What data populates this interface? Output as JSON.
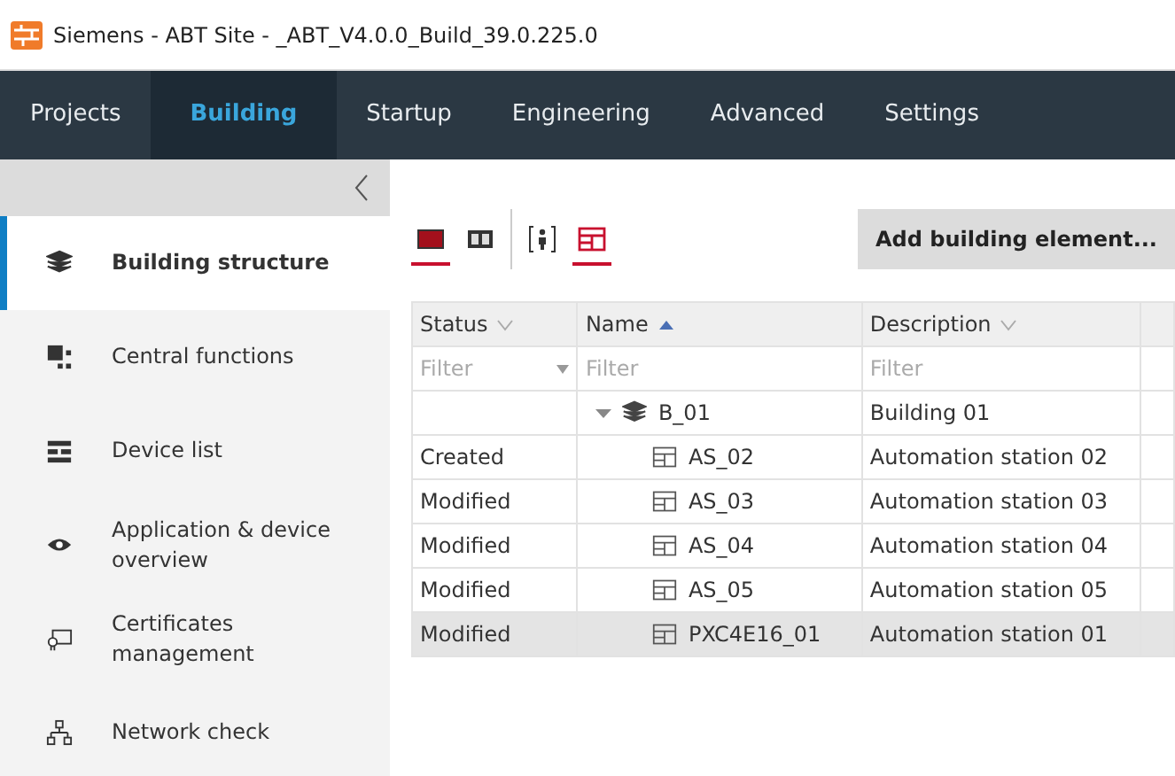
{
  "window": {
    "title": "Siemens - ABT Site - _ABT_V4.0.0_Build_39.0.225.0"
  },
  "menu_tabs": [
    {
      "label": "Projects",
      "selected": false
    },
    {
      "label": "Building",
      "selected": true
    },
    {
      "label": "Startup",
      "selected": false
    },
    {
      "label": "Engineering",
      "selected": false
    },
    {
      "label": "Advanced",
      "selected": false
    },
    {
      "label": "Settings",
      "selected": false
    }
  ],
  "sidebar": {
    "items": [
      {
        "label": "Building structure",
        "kind": "layers",
        "selected": true
      },
      {
        "label": "Central functions",
        "kind": "blocks",
        "selected": false
      },
      {
        "label": "Device list",
        "kind": "list",
        "selected": false
      },
      {
        "label": "Application & device overview",
        "kind": "eye",
        "selected": false
      },
      {
        "label": "Certificates management",
        "kind": "certificate",
        "selected": false
      },
      {
        "label": "Network check",
        "kind": "network",
        "selected": false
      }
    ]
  },
  "view_toggles": [
    {
      "kind": "full",
      "selected": true
    },
    {
      "kind": "split",
      "selected": false
    },
    {
      "kind": "person",
      "selected": false
    },
    {
      "kind": "station",
      "selected": true
    }
  ],
  "add_button": "Add building element...",
  "table": {
    "columns": [
      {
        "label": "Status",
        "sort_ascending": false,
        "filter_placeholder": "Filter",
        "filter_dropdown": true
      },
      {
        "label": "Name",
        "sort_ascending": true,
        "filter_placeholder": "Filter",
        "filter_dropdown": false
      },
      {
        "label": "Description",
        "sort_ascending": false,
        "filter_placeholder": "Filter",
        "filter_dropdown": false
      }
    ],
    "rows": [
      {
        "name": "B_01",
        "kind": "building",
        "description": "Building 01",
        "expanded": true,
        "selected": false,
        "children": [
          {
            "status": "Created",
            "name": "AS_02",
            "kind": "station",
            "description": "Automation station 02",
            "selected": false
          },
          {
            "status": "Modified",
            "name": "AS_03",
            "kind": "station",
            "description": "Automation station 03",
            "selected": false
          },
          {
            "status": "Modified",
            "name": "AS_04",
            "kind": "station",
            "description": "Automation station 04",
            "selected": false
          },
          {
            "status": "Modified",
            "name": "AS_05",
            "kind": "station",
            "description": "Automation station 05",
            "selected": false
          },
          {
            "status": "Modified",
            "name": "PXC4E16_01",
            "kind": "station",
            "description": "Automation station 01",
            "selected": true
          }
        ]
      }
    ]
  }
}
